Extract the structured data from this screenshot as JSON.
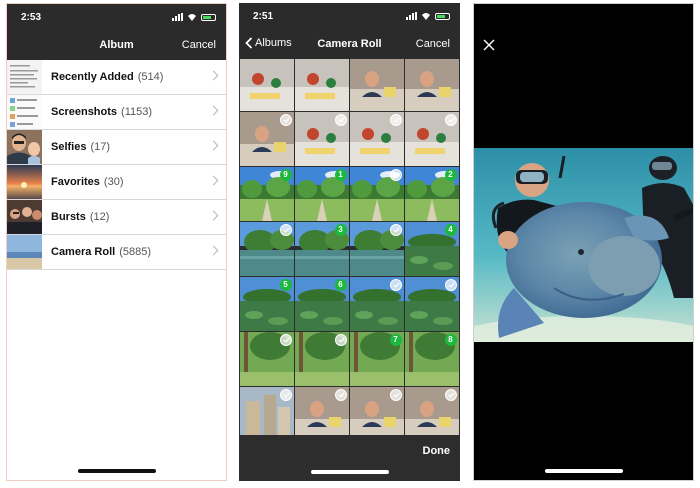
{
  "screen1": {
    "status_time": "2:53",
    "title": "Album",
    "cancel": "Cancel",
    "albums": [
      {
        "name": "Recently Added",
        "count": "(514)",
        "thumb": "doc"
      },
      {
        "name": "Screenshots",
        "count": "(1153)",
        "thumb": "screenshot"
      },
      {
        "name": "Selfies",
        "count": "(17)",
        "thumb": "selfie"
      },
      {
        "name": "Favorites",
        "count": "(30)",
        "thumb": "sunset"
      },
      {
        "name": "Bursts",
        "count": "(12)",
        "thumb": "crowd"
      },
      {
        "name": "Camera Roll",
        "count": "(5885)",
        "thumb": "beach"
      }
    ]
  },
  "screen2": {
    "status_time": "2:51",
    "back": "Albums",
    "title": "Camera Roll",
    "cancel": "Cancel",
    "done": "Done",
    "photos": [
      {
        "scene": "party",
        "badge": ""
      },
      {
        "scene": "party",
        "badge": ""
      },
      {
        "scene": "indoor",
        "badge": ""
      },
      {
        "scene": "indoor",
        "badge": ""
      },
      {
        "scene": "indoor",
        "badge": "check"
      },
      {
        "scene": "party",
        "badge": "check"
      },
      {
        "scene": "party",
        "badge": "check"
      },
      {
        "scene": "party",
        "badge": "check"
      },
      {
        "scene": "park",
        "badge": "9"
      },
      {
        "scene": "park",
        "badge": "1"
      },
      {
        "scene": "park",
        "badge": "check"
      },
      {
        "scene": "park",
        "badge": "2"
      },
      {
        "scene": "water",
        "badge": "check"
      },
      {
        "scene": "water",
        "badge": "3"
      },
      {
        "scene": "water",
        "badge": "check"
      },
      {
        "scene": "lake",
        "badge": "4"
      },
      {
        "scene": "lake",
        "badge": "5"
      },
      {
        "scene": "lake",
        "badge": "6"
      },
      {
        "scene": "lake",
        "badge": "check"
      },
      {
        "scene": "lake",
        "badge": "check"
      },
      {
        "scene": "garden",
        "badge": "check"
      },
      {
        "scene": "garden",
        "badge": "check"
      },
      {
        "scene": "garden",
        "badge": "7"
      },
      {
        "scene": "garden",
        "badge": "8"
      },
      {
        "scene": "city",
        "badge": "check"
      },
      {
        "scene": "indoor",
        "badge": "check"
      },
      {
        "scene": "indoor",
        "badge": "check"
      },
      {
        "scene": "indoor",
        "badge": "check"
      },
      {
        "scene": "food",
        "badge": "check"
      },
      {
        "scene": "food",
        "badge": "check"
      },
      {
        "scene": "food",
        "badge": "check"
      },
      {
        "scene": "food",
        "badge": "check"
      }
    ]
  },
  "screen3": {
    "photo": "diver with large fish underwater"
  },
  "colors": {
    "bar": "#2b2b2b",
    "selected_badge": "#1db83e",
    "chevron": "#b5b5b5",
    "battery": "#4cd964"
  }
}
